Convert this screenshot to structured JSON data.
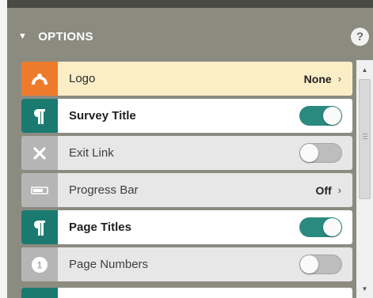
{
  "options_panel": {
    "header": {
      "title": "OPTIONS",
      "collapse_icon": "caret-down-icon",
      "help_label": "?"
    },
    "rows": [
      {
        "label": "Logo",
        "icon": "logo-icon",
        "icon_color": "#ee7b2b",
        "control": "link",
        "value": "None"
      },
      {
        "label": "Survey Title",
        "icon": "pilcrow-icon",
        "icon_color": "#1a7a70",
        "control": "toggle",
        "on": true
      },
      {
        "label": "Exit Link",
        "icon": "close-x-icon",
        "icon_color": "#b5b5b5",
        "control": "toggle",
        "on": false
      },
      {
        "label": "Progress Bar",
        "icon": "progress-bar-icon",
        "icon_color": "#b5b5b5",
        "control": "link",
        "value": "Off"
      },
      {
        "label": "Page Titles",
        "icon": "pilcrow-icon",
        "icon_color": "#1a7a70",
        "control": "toggle",
        "on": true
      },
      {
        "label": "Page Numbers",
        "icon": "page-number-icon",
        "icon_color": "#b5b5b5",
        "control": "toggle",
        "on": false,
        "icon_text": "1"
      }
    ],
    "colors": {
      "panel_bg": "#8b8b80",
      "accent_teal": "#1a7a70",
      "accent_orange": "#ee7b2b",
      "selected_row_bg": "#fbeec7"
    }
  }
}
